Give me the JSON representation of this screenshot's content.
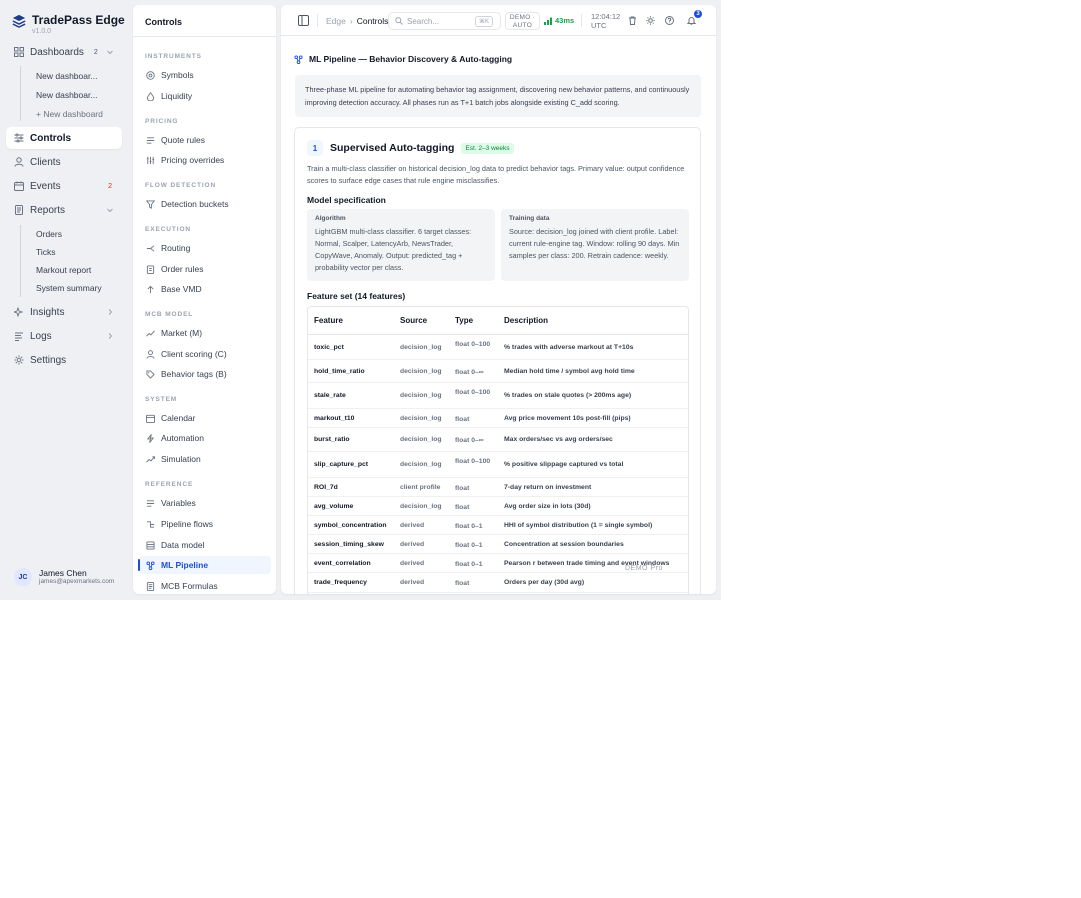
{
  "app": {
    "name": "TradePass Edge",
    "version": "v1.0.0"
  },
  "nav": {
    "dashboards": {
      "label": "Dashboards",
      "count": "2"
    },
    "dashboard_items": [
      "New dashboar...",
      "New dashboar...",
      "+ New dashboard"
    ],
    "controls": "Controls",
    "clients": "Clients",
    "events": {
      "label": "Events",
      "count": "2"
    },
    "reports": "Reports",
    "report_items": [
      "Orders",
      "Ticks",
      "Markout report",
      "System summary"
    ],
    "insights": "Insights",
    "logs": "Logs",
    "settings": "Settings"
  },
  "user": {
    "initials": "JC",
    "name": "James Chen",
    "email": "james@apexmarkets.com"
  },
  "panel": {
    "title": "Controls",
    "sections": {
      "instruments": "INSTRUMENTS",
      "pricing": "PRICING",
      "flow_detection": "FLOW DETECTION",
      "execution": "EXECUTION",
      "mcb_model": "MCB MODEL",
      "system": "SYSTEM",
      "reference": "REFERENCE"
    },
    "items": {
      "symbols": "Symbols",
      "liquidity": "Liquidity",
      "quote_rules": "Quote rules",
      "pricing_overrides": "Pricing overrides",
      "detection_buckets": "Detection buckets",
      "routing": "Routing",
      "order_rules": "Order rules",
      "base_vmd": "Base VMD",
      "market_m": "Market (M)",
      "client_scoring": "Client scoring (C)",
      "behavior_tags": "Behavior tags (B)",
      "calendar": "Calendar",
      "automation": "Automation",
      "simulation": "Simulation",
      "variables": "Variables",
      "pipeline_flows": "Pipeline flows",
      "data_model": "Data model",
      "ml_pipeline": "ML Pipeline",
      "mcb_formulas": "MCB Formulas"
    }
  },
  "topbar": {
    "breadcrumb_root": "Edge",
    "breadcrumb_sep": "›",
    "breadcrumb_current": "Controls",
    "search_placeholder": "Search...",
    "search_shortcut": "⌘K",
    "mode_line1": "DEMO ·",
    "mode_line2": "AUTO",
    "latency": "43ms",
    "time": "12:04:12",
    "timezone": "UTC",
    "notifications": "3"
  },
  "page": {
    "title": "ML Pipeline — Behavior Discovery & Auto-tagging",
    "intro": "Three-phase ML pipeline for automating behavior tag assignment, discovering new behavior patterns, and continuously improving detection accuracy. All phases run as T+1 batch jobs alongside existing C_add scoring."
  },
  "phase1": {
    "number": "1",
    "title": "Supervised Auto-tagging",
    "estimate": "Est. 2–3 weeks",
    "description": "Train a multi-class classifier on historical decision_log data to predict behavior tags. Primary value: output confidence scores to surface edge cases that rule engine misclassifies.",
    "spec_heading": "Model specification",
    "algorithm_label": "Algorithm",
    "algorithm_text": "LightGBM multi-class classifier. 6 target classes: Normal, Scalper, LatencyArb, NewsTrader, CopyWave, Anomaly. Output: predicted_tag + probability vector per class.",
    "training_label": "Training data",
    "training_text": "Source: decision_log joined with client profile. Label: current rule-engine tag. Window: rolling 90 days. Min samples per class: 200. Retrain cadence: weekly.",
    "feature_heading": "Feature set (14 features)",
    "columns": [
      "Feature",
      "Source",
      "Type",
      "Description"
    ],
    "features": [
      {
        "feature": "toxic_pct",
        "source": "decision_log",
        "type": "float 0–100",
        "description": "% trades with adverse markout at T+10s"
      },
      {
        "feature": "hold_time_ratio",
        "source": "decision_log",
        "type": "float 0–∞",
        "description": "Median hold time / symbol avg hold time"
      },
      {
        "feature": "stale_rate",
        "source": "decision_log",
        "type": "float 0–100",
        "description": "% trades on stale quotes (> 200ms age)"
      },
      {
        "feature": "markout_t10",
        "source": "decision_log",
        "type": "float",
        "description": "Avg price movement 10s post-fill (pips)"
      },
      {
        "feature": "burst_ratio",
        "source": "decision_log",
        "type": "float 0–∞",
        "description": "Max orders/sec vs avg orders/sec"
      },
      {
        "feature": "slip_capture_pct",
        "source": "decision_log",
        "type": "float 0–100",
        "description": "% positive slippage captured vs total"
      },
      {
        "feature": "ROI_7d",
        "source": "client profile",
        "type": "float",
        "description": "7-day return on investment"
      },
      {
        "feature": "avg_volume",
        "source": "decision_log",
        "type": "float",
        "description": "Avg order size in lots (30d)"
      },
      {
        "feature": "symbol_concentration",
        "source": "derived",
        "type": "float 0–1",
        "description": "HHI of symbol distribution (1 = single symbol)"
      },
      {
        "feature": "session_timing_skew",
        "source": "derived",
        "type": "float 0–1",
        "description": "Concentration at session boundaries"
      },
      {
        "feature": "event_correlation",
        "source": "derived",
        "type": "float 0–1",
        "description": "Pearson r between trade timing and event windows"
      },
      {
        "feature": "trade_frequency",
        "source": "derived",
        "type": "float",
        "description": "Orders per day (30d avg)"
      }
    ]
  },
  "watermark": "DEMO Pro"
}
